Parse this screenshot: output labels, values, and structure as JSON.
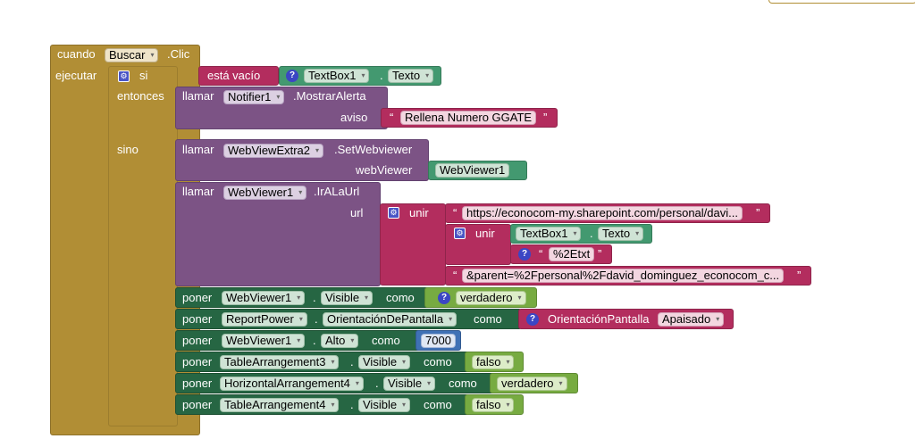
{
  "event": {
    "cuando": "cuando",
    "component": "Buscar",
    "event": ".Clic",
    "ejecutar": "ejecutar"
  },
  "if_block": {
    "si": "si",
    "entonces": "entonces",
    "sino": "sino",
    "is_empty": "está vacío",
    "textbox": "TextBox1",
    "texto": "Texto",
    "dot": "."
  },
  "notifier": {
    "llamar": "llamar",
    "component": "Notifier1",
    "method": ".MostrarAlerta",
    "param": "aviso",
    "message": "Rellena Numero GGATE"
  },
  "webviewextra": {
    "llamar": "llamar",
    "component": "WebViewExtra2",
    "method": ".SetWebviewer",
    "param": "webViewer",
    "value": "WebViewer1"
  },
  "goto_url": {
    "llamar": "llamar",
    "component": "WebViewer1",
    "method": ".IrALaUrl",
    "param": "url",
    "unir": "unir",
    "url_part1": "https://econocom-my.sharepoint.com/personal/davi...",
    "textbox": "TextBox1",
    "texto": "Texto",
    "encoded": "%2Etxt",
    "url_part2": "&parent=%2Fpersonal%2Fdavid_dominguez_econocom_c..."
  },
  "setters": [
    {
      "poner": "poner",
      "component": "WebViewer1",
      "property": "Visible",
      "como": "como",
      "value": "verdadero"
    },
    {
      "poner": "poner",
      "component": "ReportPower",
      "property": "OrientaciónDePantalla",
      "como": "como",
      "value_label": "OrientaciónPantalla",
      "value": "Apaisado"
    },
    {
      "poner": "poner",
      "component": "WebViewer1",
      "property": "Alto",
      "como": "como",
      "value": "7000"
    },
    {
      "poner": "poner",
      "component": "TableArrangement3",
      "property": "Visible",
      "como": "como",
      "value": "falso"
    },
    {
      "poner": "poner",
      "component": "HorizontalArrangement4",
      "property": "Visible",
      "como": "como",
      "value": "verdadero"
    },
    {
      "poner": "poner",
      "component": "TableArrangement4",
      "property": "Visible",
      "como": "como",
      "value": "falso"
    }
  ],
  "symbols": {
    "open_quote": "“",
    "close_quote": "”",
    "question": "?",
    "gear": "⚙",
    "arrow": "▾"
  },
  "colors": {
    "event": "#b18e35",
    "procedure": "#7c5385",
    "setter": "#266643",
    "logic": "#77ab41",
    "text": "#b32d5e",
    "component": "#439970",
    "math": "#3f71b5"
  }
}
